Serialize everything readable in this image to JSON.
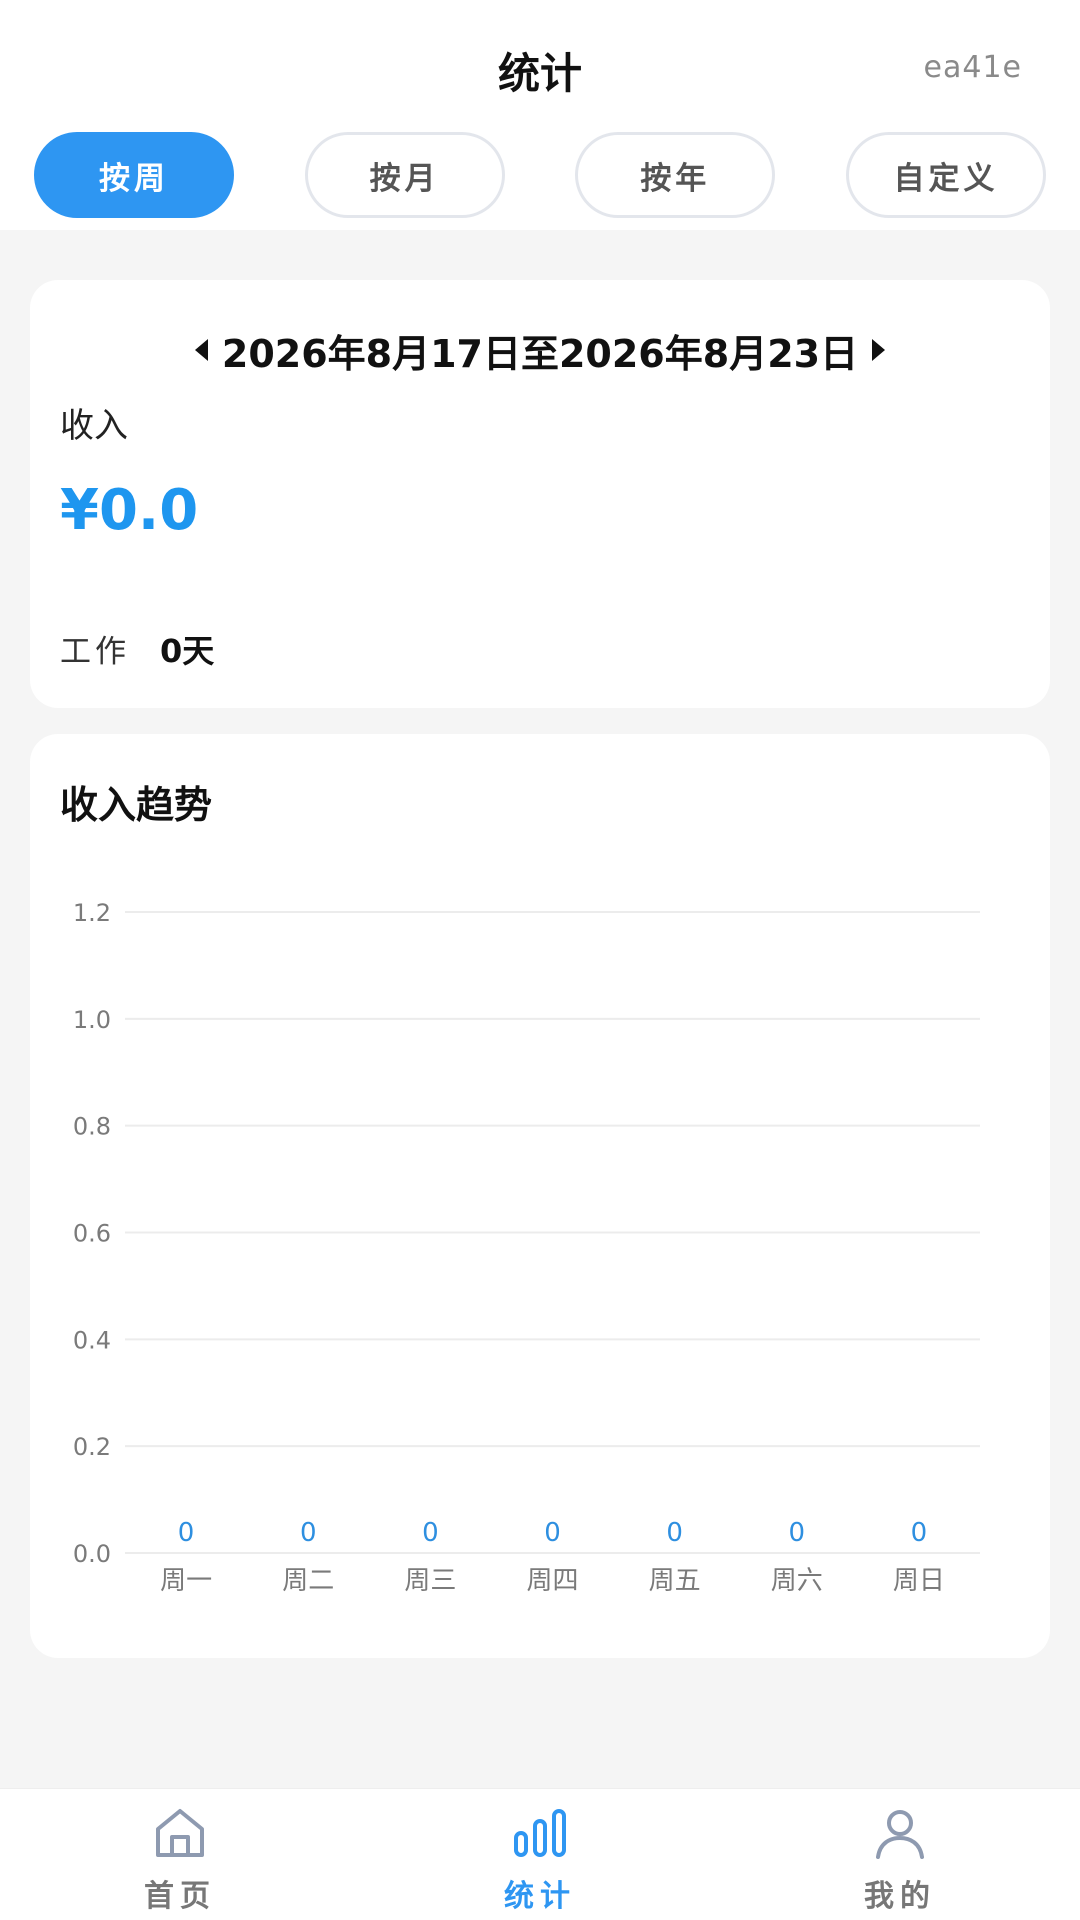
{
  "header": {
    "title": "统计",
    "user_id": "ea41e"
  },
  "tabs": [
    {
      "label": "按周",
      "active": true
    },
    {
      "label": "按月",
      "active": false
    },
    {
      "label": "按年",
      "active": false
    },
    {
      "label": "自定义",
      "active": false
    }
  ],
  "summary": {
    "date_range": "2026年8月17日至2026年8月23日",
    "income_label": "收入",
    "income_value": "¥0.0",
    "work_label": "工作",
    "work_value": "0天"
  },
  "chart_title": "收入趋势",
  "chart_data": {
    "type": "bar",
    "categories": [
      "周一",
      "周二",
      "周三",
      "周四",
      "周五",
      "周六",
      "周日"
    ],
    "values": [
      0,
      0,
      0,
      0,
      0,
      0,
      0
    ],
    "value_labels": [
      "0",
      "0",
      "0",
      "0",
      "0",
      "0",
      "0"
    ],
    "yticks": [
      "0.0",
      "0.2",
      "0.4",
      "0.6",
      "0.8",
      "1.0",
      "1.2"
    ],
    "ylim": [
      0,
      1.2
    ],
    "grid": true,
    "colors": {
      "label": "#2e8fe0",
      "tick": "#7a7a7a",
      "grid": "#ececec",
      "bar": "#2e96f2"
    }
  },
  "bottom_nav": [
    {
      "label": "首页",
      "icon": "home-icon",
      "active": false
    },
    {
      "label": "统计",
      "icon": "bar-chart-icon",
      "active": true
    },
    {
      "label": "我的",
      "icon": "user-icon",
      "active": false
    }
  ],
  "colors": {
    "accent": "#2e96f2",
    "income": "#1e96ef",
    "background": "#f5f5f5"
  }
}
